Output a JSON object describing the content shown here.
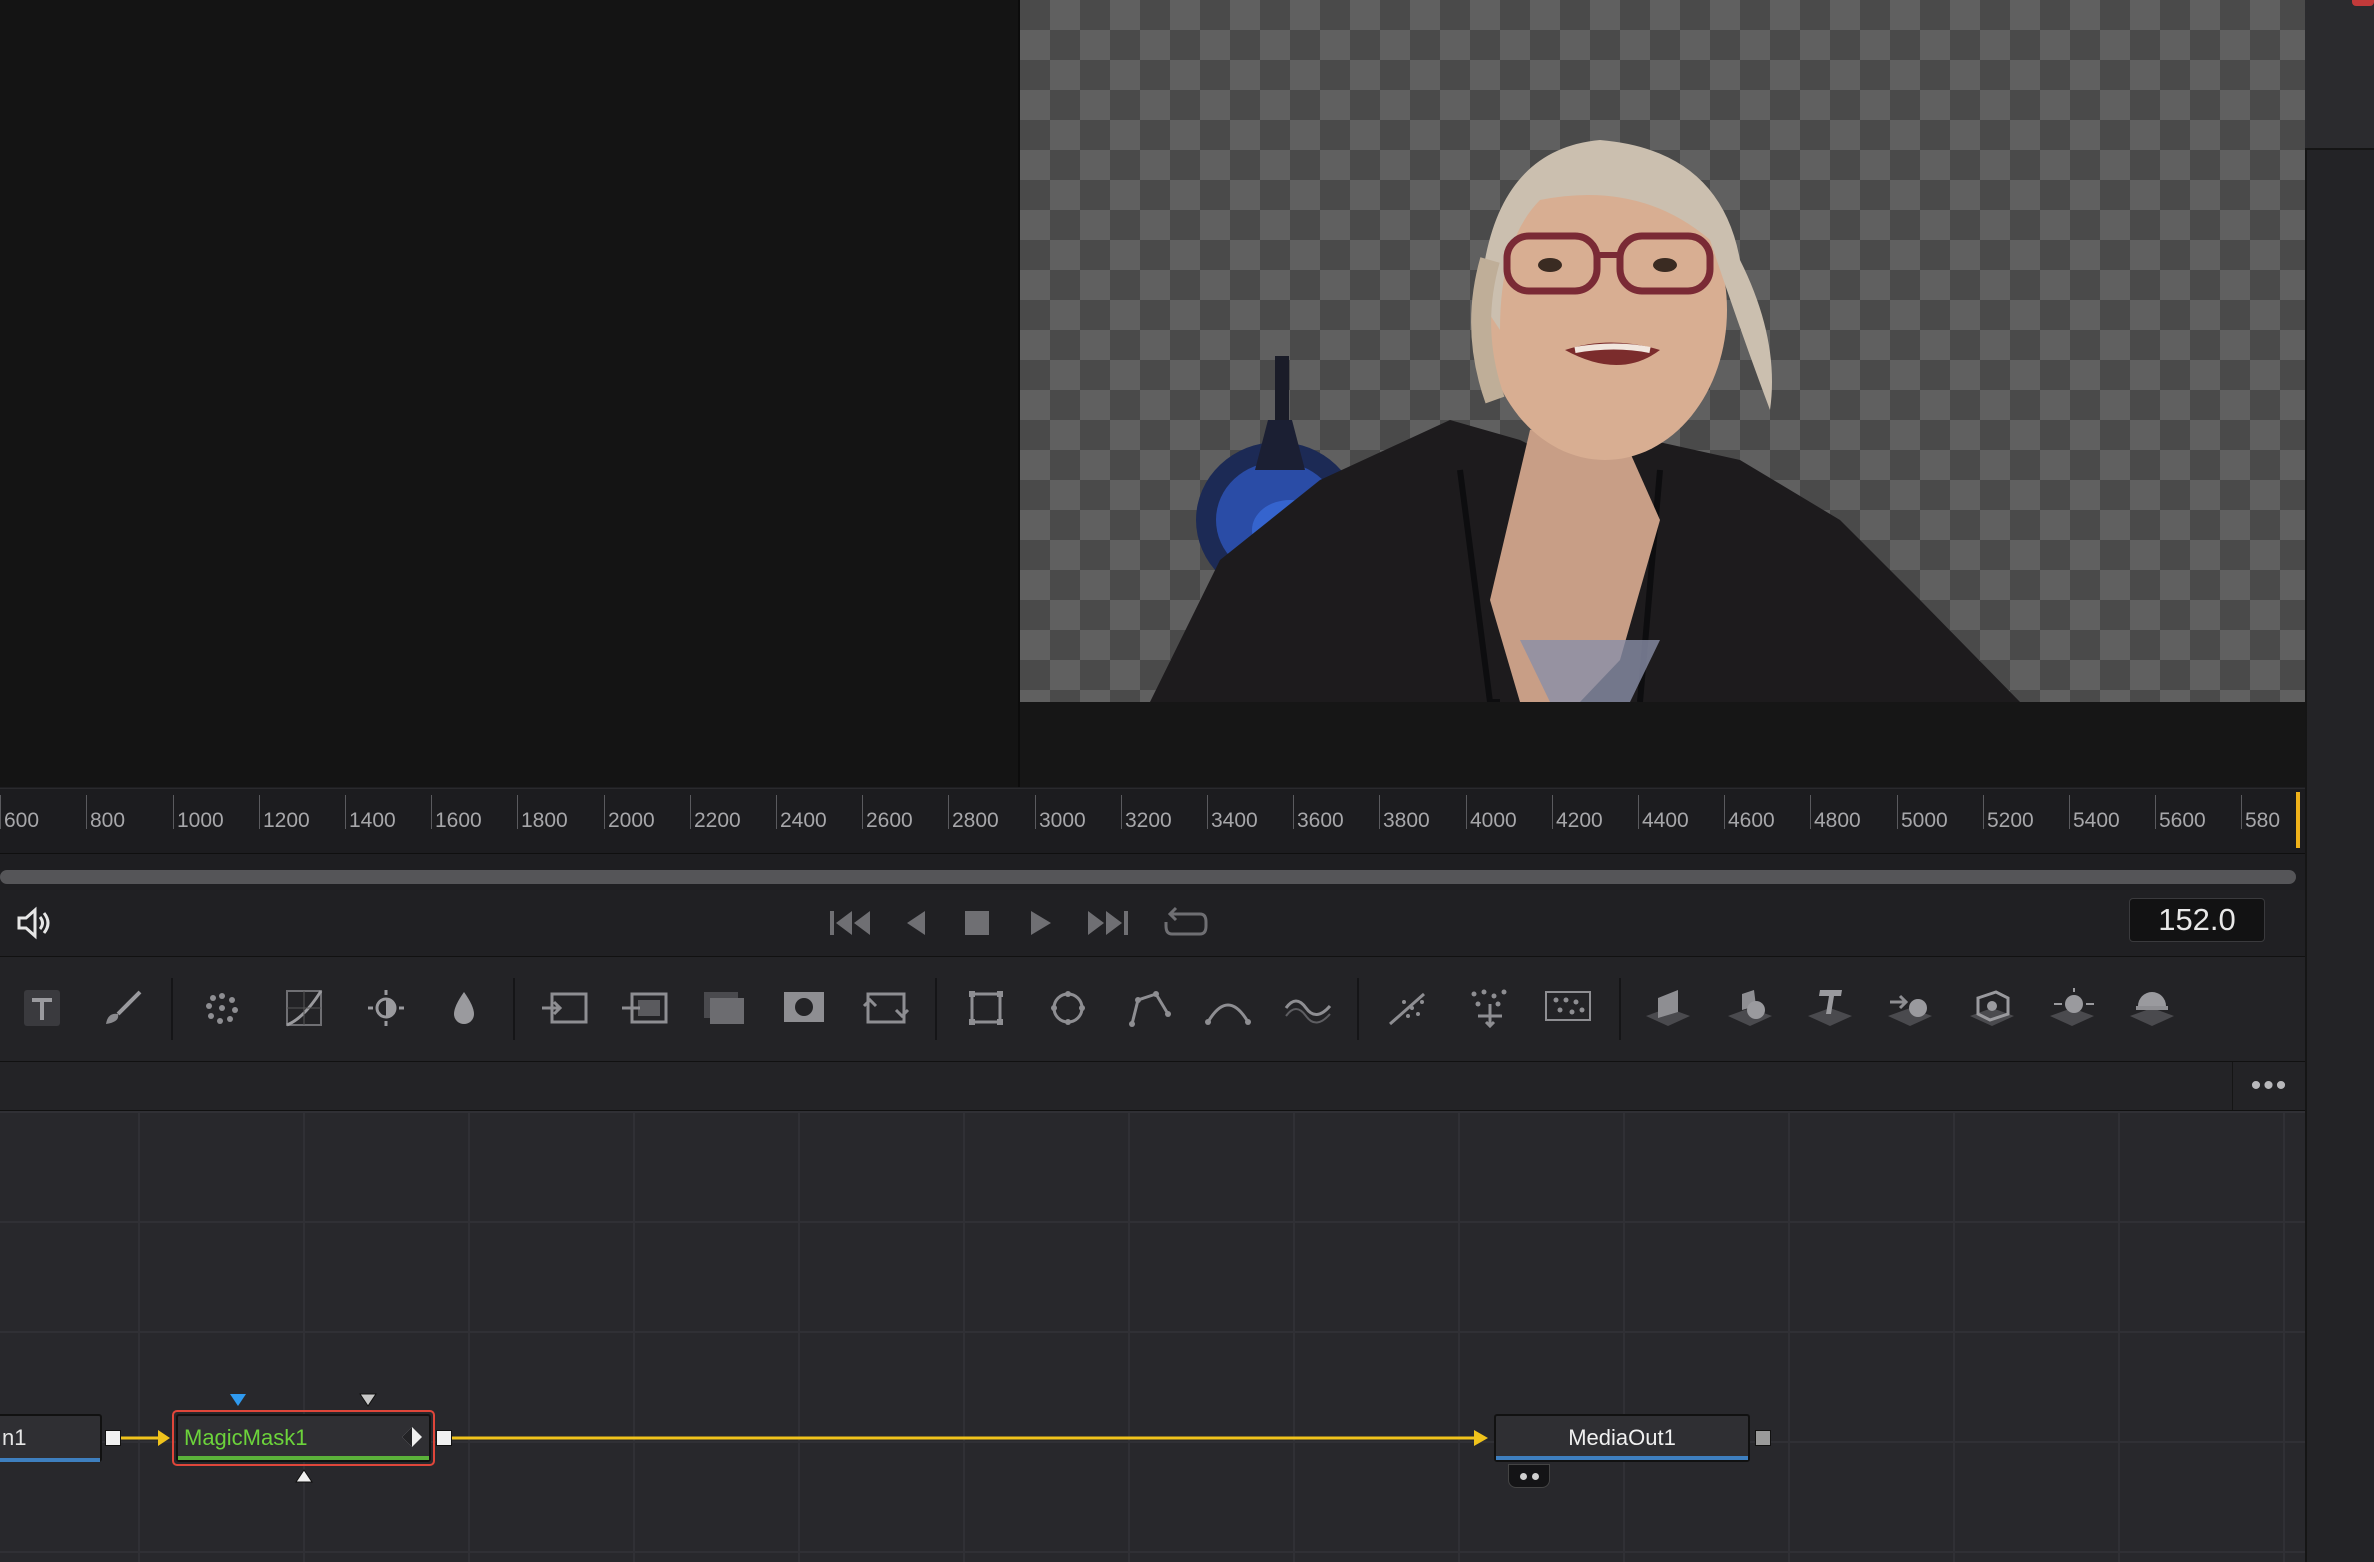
{
  "viewer": {
    "right_content": "person-on-transparency"
  },
  "ruler": {
    "ticks": [
      "600",
      "800",
      "1000",
      "1200",
      "1400",
      "1600",
      "1800",
      "2000",
      "2200",
      "2400",
      "2600",
      "2800",
      "3000",
      "3200",
      "3400",
      "3600",
      "3800",
      "4000",
      "4200",
      "4400",
      "4600",
      "4800",
      "5000",
      "5200",
      "5400",
      "5600",
      "580"
    ]
  },
  "transport": {
    "timecode": "152.0",
    "buttons": [
      "audio-icon",
      "skip-to-start-icon",
      "step-back-icon",
      "stop-icon",
      "play-icon",
      "skip-to-end-icon",
      "loop-icon"
    ]
  },
  "toolbar": {
    "tools": [
      "text-tool-icon",
      "paint-tool-icon",
      "particles-icon",
      "curves-icon",
      "brightness-contrast-icon",
      "color-drop-icon",
      "merge-icon",
      "merge-alt-icon",
      "channel-booleans-icon",
      "matte-control-icon",
      "transform-icon",
      "rectangle-mask-icon",
      "ellipse-mask-icon",
      "polygon-mask-icon",
      "bspline-mask-icon",
      "wave-mask-icon",
      "particle-emitter-icon",
      "particle-render-icon",
      "particle-grid-icon",
      "shape-3d-icon",
      "merge-3d-icon",
      "text-3d-icon",
      "camera-3d-icon",
      "image-plane-3d-icon",
      "light-3d-icon",
      "render-3d-icon"
    ]
  },
  "node_header": {
    "more_label": "•••"
  },
  "nodes": {
    "left_partial": "n1",
    "magicmask": "MagicMask1",
    "mediaout": "MediaOut1"
  },
  "colors": {
    "connection": "#f0c31c",
    "selected_border": "#e0463a",
    "magicmask_text": "#6cd33b",
    "playhead": "#f0b21a",
    "underline": "#3e7fbf"
  }
}
